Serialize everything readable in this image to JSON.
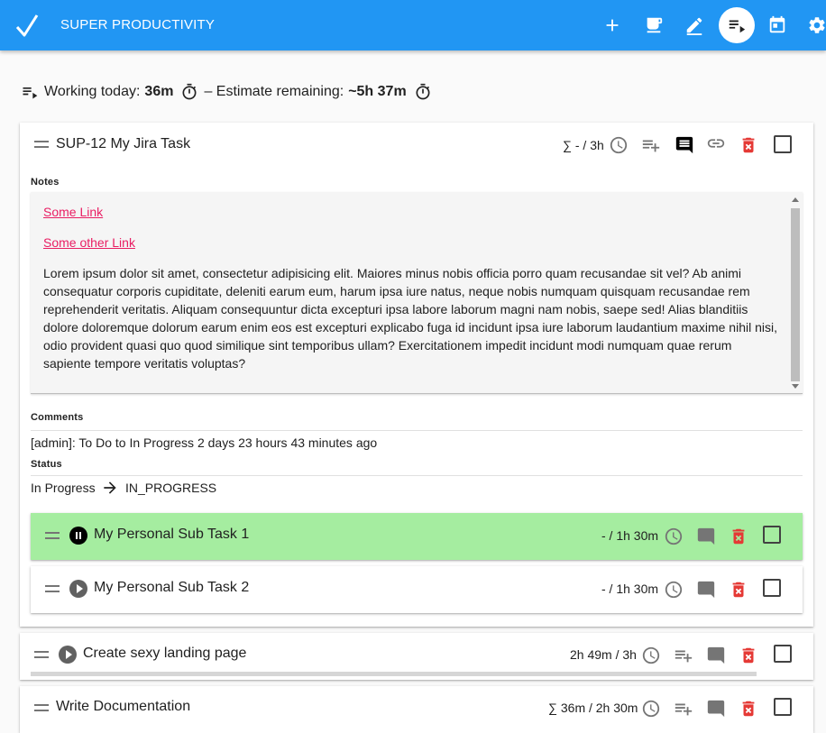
{
  "app": {
    "title": "SUPER PRODUCTIVITY"
  },
  "toolbar": {
    "buttons": [
      {
        "name": "add-task-button",
        "icon": "plus-icon"
      },
      {
        "name": "break-button",
        "icon": "coffee-icon"
      },
      {
        "name": "edit-button",
        "icon": "pencil-icon"
      },
      {
        "name": "work-view-button",
        "icon": "playlist-play-icon",
        "active": true
      },
      {
        "name": "schedule-button",
        "icon": "calendar-icon"
      },
      {
        "name": "settings-button",
        "icon": "gear-icon"
      }
    ]
  },
  "summary": {
    "working_label": "Working today:",
    "working_value": "36m",
    "estimate_label": "– Estimate remaining:",
    "estimate_value": "~5h 37m"
  },
  "tasks": [
    {
      "title": "SUP-12 My Jira Task",
      "time": "∑ - / 3h",
      "notes_label": "Notes",
      "links": [
        "Some Link",
        "Some other Link"
      ],
      "notes_text": "Lorem ipsum dolor sit amet, consectetur adipisicing elit. Maiores minus nobis officia porro quam recusandae sit vel? Ab animi consequatur corporis cupiditate, deleniti earum eum, harum ipsa iure natus, neque nobis numquam quisquam recusandae rem reprehenderit veritatis. Aliquam consequuntur dicta excepturi ipsa labore laborum magni nam nobis, saepe sed! Alias blanditiis dolore doloremque dolorum earum enim eos est excepturi explicabo fuga id incidunt ipsa iure laborum laudantium maxime nihil nisi, odio provident quasi quo quod similique sint temporibus ullam? Exercitationem impedit incidunt modi numquam quae rerum sapiente tempore veritatis voluptas?",
      "comments_label": "Comments",
      "comment": "[admin]: To Do to In Progress 2 days 23 hours 43 minutes ago",
      "status_label": "Status",
      "status_from": "In Progress",
      "status_to": "IN_PROGRESS",
      "subtasks": [
        {
          "title": "My Personal Sub Task 1",
          "time": "- / 1h 30m",
          "active": true
        },
        {
          "title": "My Personal Sub Task 2",
          "time": "- / 1h 30m",
          "active": false
        }
      ]
    },
    {
      "title": "Create sexy landing page",
      "time": "2h 49m / 3h"
    },
    {
      "title": "Write Documentation",
      "time": "∑ 36m / 2h 30m"
    }
  ],
  "colors": {
    "primary": "#2196f3",
    "active_task": "#a5eda0",
    "link": "#e91e63",
    "delete": "#e53935"
  }
}
